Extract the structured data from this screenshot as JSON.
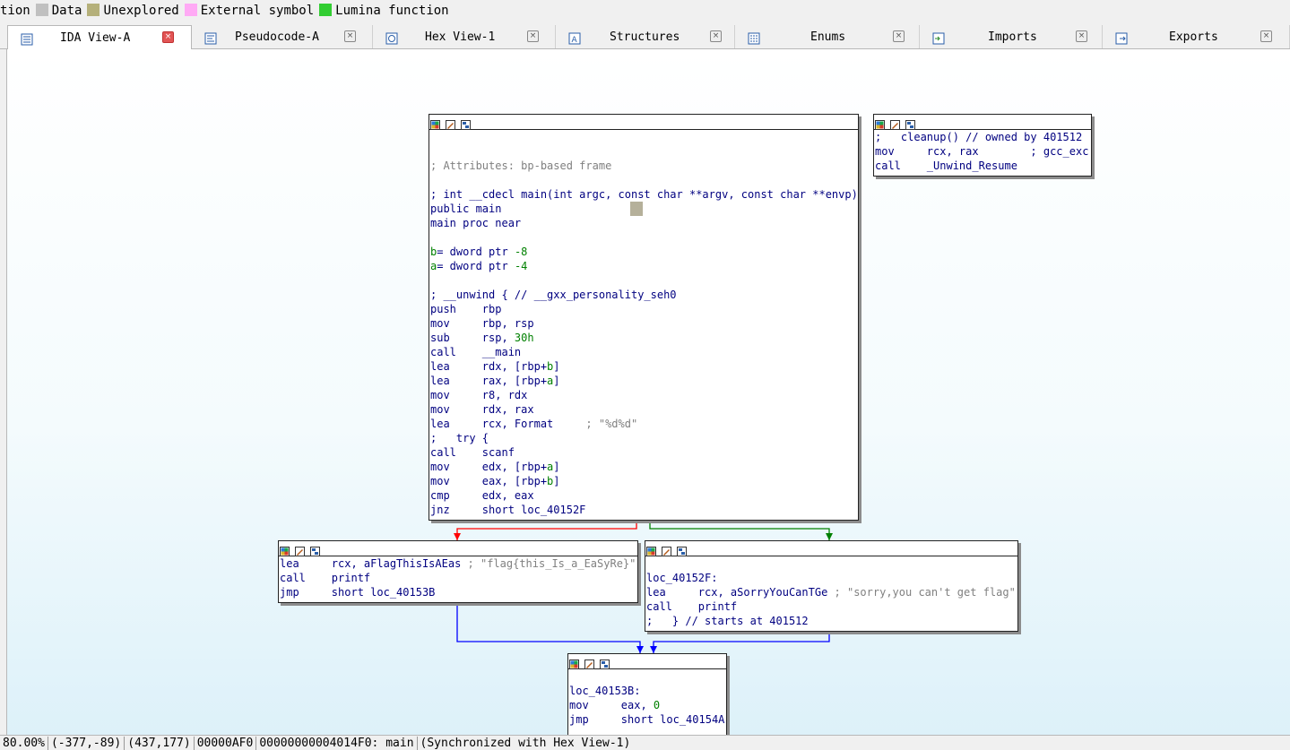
{
  "legend": [
    {
      "label": "tion",
      "color": ""
    },
    {
      "label": "Data",
      "color": "#c0c0c0"
    },
    {
      "label": "Unexplored",
      "color": "#b5b07a"
    },
    {
      "label": "External symbol",
      "color": "#ffaaf5"
    },
    {
      "label": "Lumina function",
      "color": "#32cd32"
    }
  ],
  "tabs": [
    {
      "label": "IDA View-A",
      "active": true
    },
    {
      "label": "Pseudocode-A",
      "active": false
    },
    {
      "label": "Hex View-1",
      "active": false
    },
    {
      "label": "Structures",
      "active": false
    },
    {
      "label": "Enums",
      "active": false
    },
    {
      "label": "Imports",
      "active": false
    },
    {
      "label": "Exports",
      "active": false
    }
  ],
  "nodes": {
    "main": {
      "lines": [
        "",
        "",
        "; Attributes: bp-based frame",
        "",
        "; int __cdecl main(int argc, const char **argv, const char **envp)",
        "public main",
        "main proc near",
        "",
        "b= dword ptr -8",
        "a= dword ptr -4",
        "",
        "; __unwind { // __gxx_personality_seh0",
        "push    rbp",
        "mov     rbp, rsp",
        "sub     rsp, 30h",
        "call    __main",
        "lea     rdx, [rbp+b]",
        "lea     rax, [rbp+a]",
        "mov     r8, rdx",
        "mov     rdx, rax",
        "lea     rcx, Format     ; \"%d%d\"",
        ";   try {",
        "call    scanf",
        "mov     edx, [rbp+a]",
        "mov     eax, [rbp+b]",
        "cmp     edx, eax",
        "jnz     short loc_40152F"
      ]
    },
    "cleanup": {
      "lines": [
        ";   cleanup() // owned by 401512",
        "mov     rcx, rax        ; gcc_exc",
        "call    _Unwind_Resume"
      ]
    },
    "flag": {
      "lines": [
        "lea     rcx, aFlagThisIsAEas ; \"flag{this_Is_a_EaSyRe}\"",
        "call    printf",
        "jmp     short loc_40153B"
      ]
    },
    "sorry": {
      "lines": [
        "",
        "loc_40152F:",
        "lea     rcx, aSorryYouCanTGe ; \"sorry,you can't get flag\"",
        "call    printf",
        ";   } // starts at 401512"
      ]
    },
    "end": {
      "lines": [
        "",
        "loc_40153B:",
        "mov     eax, 0",
        "jmp     short loc_40154A"
      ]
    }
  },
  "edge_colors": {
    "false": "#ff0000",
    "true": "#008000",
    "jump": "#0000ff"
  },
  "status": {
    "zoom": "80.00%",
    "mouse": "(-377,-89)",
    "pos": "(437,177)",
    "offset": "00000AF0",
    "location": "00000000004014F0: main",
    "sync": "(Synchronized with Hex View-1)"
  }
}
